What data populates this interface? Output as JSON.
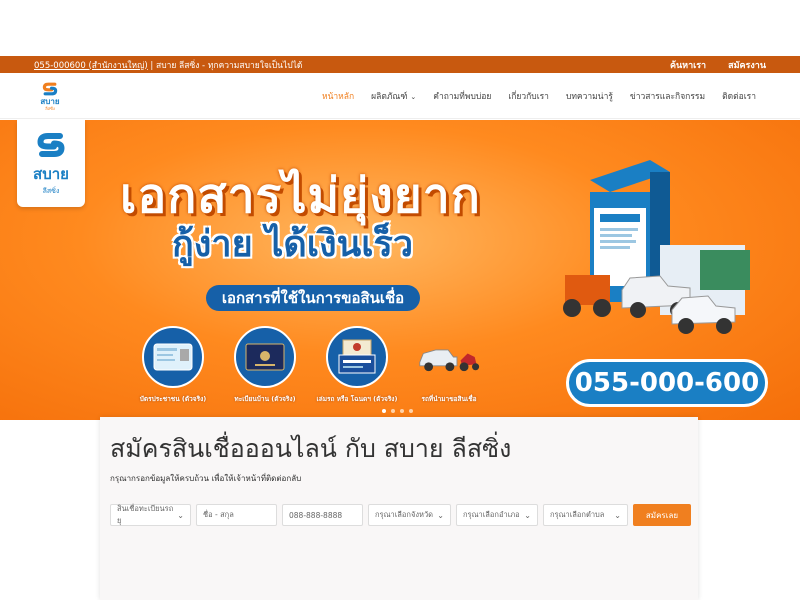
{
  "topbar": {
    "phone": "055-000600 (สำนักงานใหญ่)",
    "tagline": " | สบาย ลีสซิ่ง - ทุกความสบายใจเป็นไปได้",
    "links": [
      "ค้นหาเรา",
      "สมัครงาน"
    ]
  },
  "nav": {
    "logo_text": "สบาย",
    "logo_sub": "ลีสซิ่ง",
    "menu": [
      {
        "label": "หน้าหลัก",
        "active": true
      },
      {
        "label": "ผลิตภัณฑ์",
        "has_dropdown": true
      },
      {
        "label": "คำถามที่พบบ่อย"
      },
      {
        "label": "เกี่ยวกับเรา"
      },
      {
        "label": "บทความน่ารู้"
      },
      {
        "label": "ข่าวสารและกิจกรรม"
      },
      {
        "label": "ติดต่อเรา"
      }
    ]
  },
  "hero": {
    "logo_text": "สบาย",
    "logo_sub": "ลีสซิ่ง",
    "headline1": "เอกสารไม่ยุ่งยาก",
    "headline2": "กู้ง่าย ได้เงินเร็ว",
    "docs_title": "เอกสารที่ใช้ในการขอสินเชื่อ",
    "docs": [
      "บัตรประชาชน (ตัวจริง)",
      "ทะเบียนบ้าน (ตัวจริง)",
      "เล่มรถ หรือ โฉนดฯ (ตัวจริง)",
      "รถที่นำมาขอสินเชื่อ"
    ],
    "phone": "055-000-600",
    "slide_count": 4,
    "active_slide": 0
  },
  "form": {
    "title": "สมัครสินเชื่อออนไลน์ กับ สบาย ลีสซิ่ง",
    "subtitle": "กรุณากรอกข้อมูลให้ครบถ้วน เพื่อให้เจ้าหน้าที่ติดต่อกลับ",
    "loan_type": "สินเชื่อทะเบียนรถยุ",
    "name_placeholder": "ชื่อ - สกุล",
    "phone_placeholder": "088-888-8888",
    "province": "กรุณาเลือกจังหวัด",
    "district": "กรุณาเลือกอำเภอ",
    "subdistrict": "กรุณาเลือกตำบล",
    "submit": "สมัครเลย"
  },
  "colors": {
    "brand_orange": "#f07f1f",
    "brand_blue": "#1a7fc4",
    "topbar": "#c8590f"
  }
}
